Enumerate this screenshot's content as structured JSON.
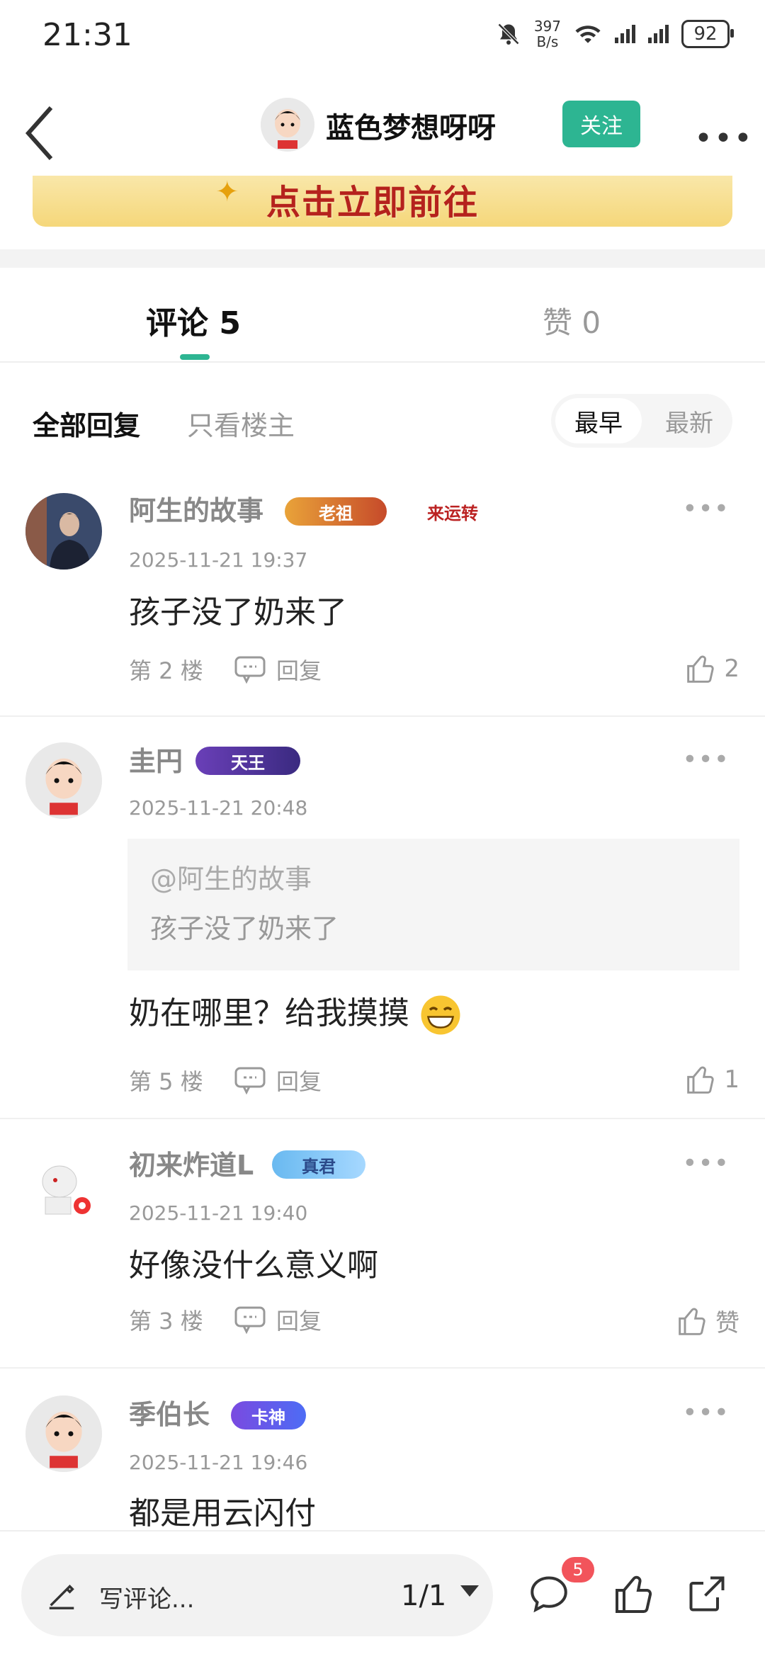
{
  "status_bar": {
    "time": "21:31",
    "net_speed_top": "397",
    "net_speed_bottom": "B/s",
    "net1": "4G",
    "net2": "4G",
    "battery": "92"
  },
  "header": {
    "title": "蓝色梦想呀呀",
    "follow_label": "关注",
    "more": "•••"
  },
  "banner": {
    "text": "点击立即前往"
  },
  "tabs": {
    "comments_label": "评论 5",
    "likes_label": "赞 0"
  },
  "filters": {
    "all": "全部回复",
    "op_only": "只看楼主",
    "sort_early": "最早",
    "sort_new": "最新"
  },
  "comments": [
    {
      "name": "阿生的故事",
      "badges": [
        "老祖",
        "来运转"
      ],
      "time": "2025-11-21 19:37",
      "text": "孩子没了奶来了",
      "floor": "第 2 楼",
      "reply": "回复",
      "likes": "2"
    },
    {
      "name": "圭円",
      "badges": [
        "天王"
      ],
      "time": "2025-11-21 20:48",
      "quote_name": "@阿生的故事",
      "quote_text": "孩子没了奶来了",
      "text": "奶在哪里？给我摸摸",
      "floor": "第 5 楼",
      "reply": "回复",
      "likes": "1"
    },
    {
      "name": "初来炸道L",
      "badges": [
        "真君"
      ],
      "time": "2025-11-21 19:40",
      "text": "好像没什么意义啊",
      "floor": "第 3 楼",
      "reply": "回复",
      "likes": "赞"
    },
    {
      "name": "季伯长",
      "badges": [
        "卡神"
      ],
      "time": "2025-11-21 19:46",
      "text": "都是用云闪付"
    }
  ],
  "bottom_bar": {
    "write_placeholder": "写评论...",
    "page": "1/1",
    "comment_count": "5"
  },
  "colors": {
    "accent": "#2db592",
    "badge_red": "#f2545b"
  }
}
